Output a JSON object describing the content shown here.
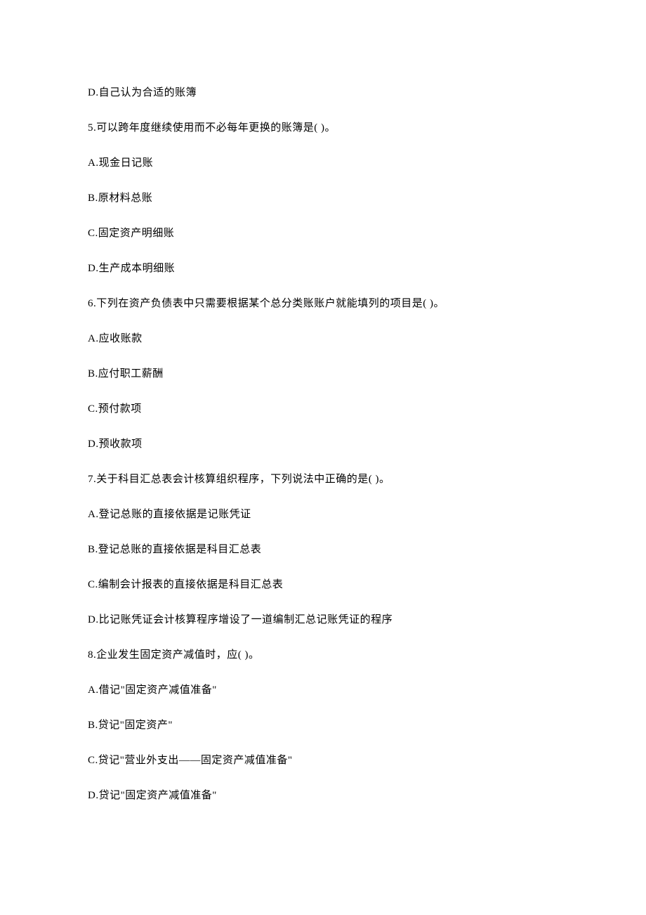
{
  "lines": [
    "D.自己认为合适的账簿",
    "5.可以跨年度继续使用而不必每年更换的账簿是(  )。",
    "A.现金日记账",
    "B.原材料总账",
    "C.固定资产明细账",
    "D.生产成本明细账",
    "6.下列在资产负债表中只需要根据某个总分类账账户就能填列的项目是(  )。",
    "A.应收账款",
    "B.应付职工薪酬",
    "C.预付款项",
    "D.预收款项",
    "7.关于科目汇总表会计核算组织程序，下列说法中正确的是(  )。",
    "A.登记总账的直接依据是记账凭证",
    "B.登记总账的直接依据是科目汇总表",
    "C.编制会计报表的直接依据是科目汇总表",
    "D.比记账凭证会计核算程序增设了一道编制汇总记账凭证的程序",
    "8.企业发生固定资产减值时，应(  )。",
    "A.借记\"固定资产减值准备\"",
    "B.贷记\"固定资产\"",
    "C.贷记\"营业外支出——固定资产减值准备\"",
    "D.贷记\"固定资产减值准备\""
  ]
}
